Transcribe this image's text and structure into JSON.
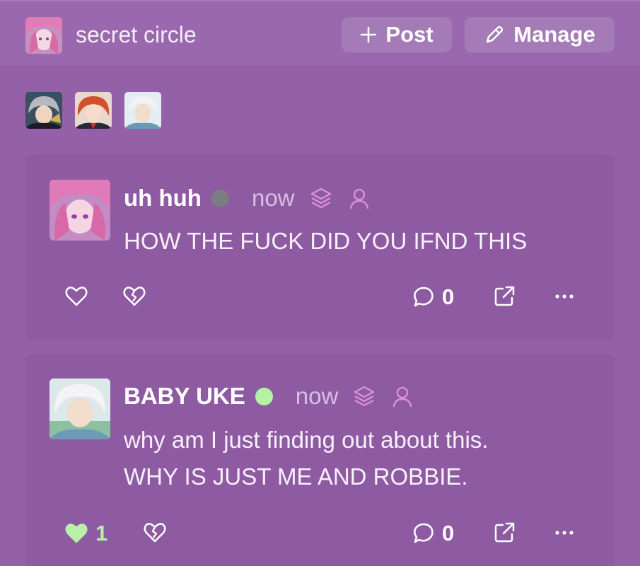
{
  "header": {
    "title": "secret circle",
    "post_label": "Post",
    "manage_label": "Manage"
  },
  "members": [
    "member-1",
    "member-2",
    "member-3"
  ],
  "posts": [
    {
      "author": "uh huh",
      "status": "offline",
      "status_color": "#7c7c84",
      "time": "now",
      "lines": [
        "HOW THE FUCK DID YOU IFND THIS"
      ],
      "likes": "",
      "comments": "0",
      "liked": false
    },
    {
      "author": "BABY UKE",
      "status": "online",
      "status_color": "#b4f3a4",
      "time": "now",
      "lines": [
        "why am I just finding out about this.",
        "WHY IS JUST ME AND ROBBIE."
      ],
      "likes": "1",
      "comments": "0",
      "liked": true
    }
  ],
  "colors": {
    "accent_pink": "#e091d8",
    "like_green": "#b8f0a8"
  }
}
